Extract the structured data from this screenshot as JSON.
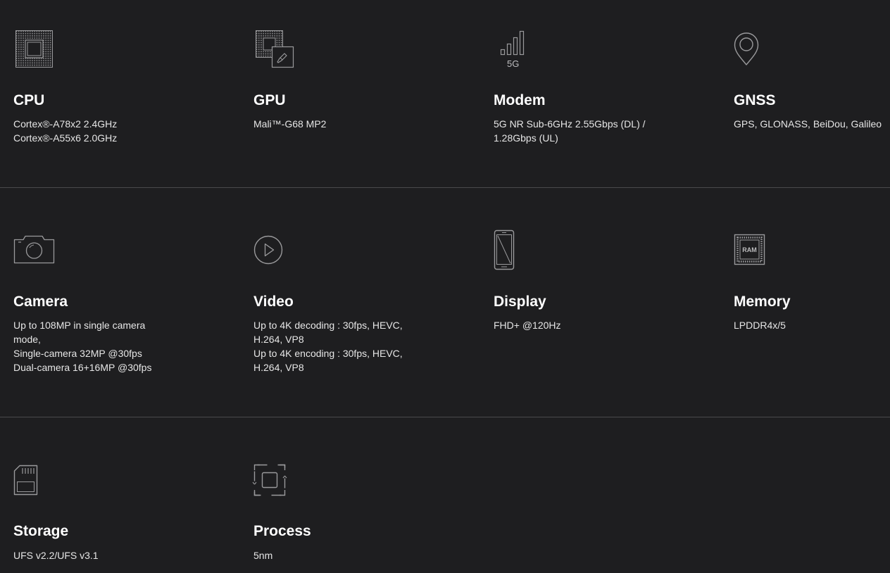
{
  "specs": {
    "cpu": {
      "icon": "cpu-chip-icon",
      "title": "CPU",
      "lines": [
        "Cortex®-A78x2 2.4GHz",
        "Cortex®-A55x6 2.0GHz"
      ]
    },
    "gpu": {
      "icon": "gpu-chip-brush-icon",
      "title": "GPU",
      "lines": [
        "Mali™-G68 MP2"
      ]
    },
    "modem": {
      "icon": "5g-signal-icon",
      "icon_label": "5G",
      "title": "Modem",
      "lines": [
        "5G NR Sub-6GHz 2.55Gbps (DL) /",
        "1.28Gbps (UL)"
      ]
    },
    "gnss": {
      "icon": "location-pin-icon",
      "title": "GNSS",
      "lines": [
        "GPS, GLONASS, BeiDou, Galileo"
      ]
    },
    "camera": {
      "icon": "camera-icon",
      "title": "Camera",
      "lines": [
        "Up to 108MP in single camera",
        "mode,",
        "Single-camera 32MP @30fps",
        "Dual-camera 16+16MP @30fps"
      ]
    },
    "video": {
      "icon": "play-circle-icon",
      "title": "Video",
      "lines": [
        "Up to 4K decoding : 30fps, HEVC,",
        "H.264, VP8",
        "Up to 4K encoding : 30fps, HEVC,",
        "H.264, VP8"
      ]
    },
    "display": {
      "icon": "smartphone-icon",
      "title": "Display",
      "lines": [
        "FHD+ @120Hz"
      ]
    },
    "memory": {
      "icon": "ram-chip-icon",
      "icon_label": "RAM",
      "title": "Memory",
      "lines": [
        "LPDDR4x/5"
      ]
    },
    "storage": {
      "icon": "sd-card-icon",
      "title": "Storage",
      "lines": [
        "UFS v2.2/UFS v3.1"
      ]
    },
    "process": {
      "icon": "process-node-icon",
      "title": "Process",
      "lines": [
        "5nm"
      ]
    }
  },
  "colors": {
    "background": "#1e1e20",
    "divider": "#4a4a4c",
    "icon_stroke": "#9a9a9c",
    "text": "#ffffff"
  }
}
